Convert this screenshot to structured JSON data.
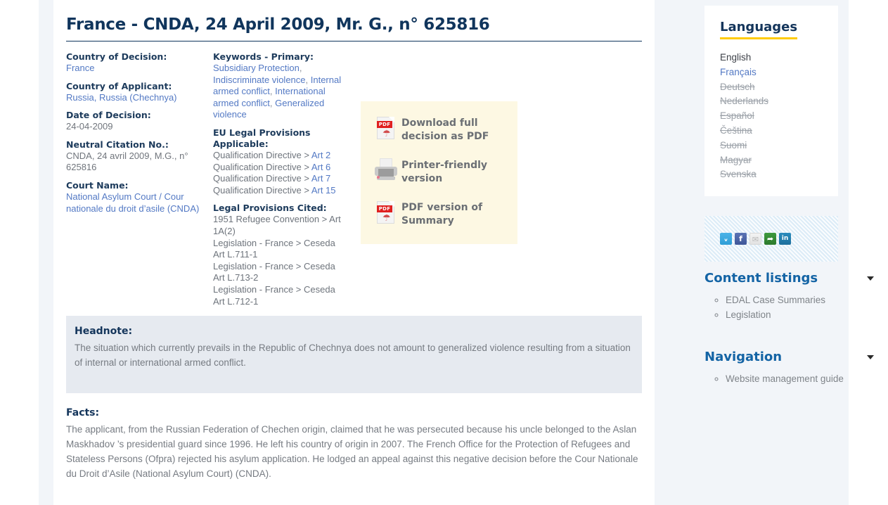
{
  "page": {
    "title": "France - CNDA, 24 April 2009, Mr. G., n° 625816"
  },
  "meta": {
    "left_fields": [
      {
        "label": "Country of Decision:",
        "value": "France",
        "is_link": true
      },
      {
        "label": "Country of Applicant:",
        "value": "Russia, Russia (Chechnya)",
        "is_link": true
      },
      {
        "label": "Date of Decision:",
        "value": "24-04-2009",
        "is_link": false
      },
      {
        "label": "Neutral Citation No.:",
        "value": "CNDA, 24 avril 2009, M.G., n° 625816",
        "is_link": false
      },
      {
        "label": "Court Name:",
        "value": "National Asylum Court / Cour nationale du droit d’asile (CNDA)",
        "is_link": true
      }
    ],
    "keywords": {
      "label": "Keywords - Primary:",
      "items": [
        "Subsidiary Protection",
        "Indiscriminate violence",
        "Internal armed conflict",
        "International armed conflict",
        "Generalized violence"
      ]
    },
    "eu_provisions": {
      "label": "EU Legal Provisions Applicable:",
      "items": [
        {
          "source": "Qualification Directive > ",
          "article": "Art 2"
        },
        {
          "source": "Qualification Directive > ",
          "article": "Art 6"
        },
        {
          "source": "Qualification Directive > ",
          "article": "Art 7"
        },
        {
          "source": "Qualification Directive > ",
          "article": "Art 15"
        }
      ]
    },
    "cited_provisions": {
      "label": "Legal Provisions Cited:",
      "items": [
        "1951 Refugee Convention > Art 1A(2)",
        "Legislation - France > Ceseda Art L.711-1",
        "Legislation - France > Ceseda Art L.713-2",
        "Legislation - France > Ceseda Art L.712-1"
      ]
    }
  },
  "downloads": {
    "items": [
      {
        "icon": "pdf-icon",
        "label": "Download full decision as PDF"
      },
      {
        "icon": "printer-icon",
        "label": "Printer-friendly version"
      },
      {
        "icon": "pdf-icon",
        "label": "PDF version of Summary"
      }
    ]
  },
  "headnote": {
    "title": "Headnote:",
    "text": "The situation which currently prevails in the Republic of Chechnya does not amount to generalized violence resulting from a situation of internal or international armed conflict."
  },
  "facts": {
    "title": "Facts:",
    "text": "The applicant, from the Russian Federation of Chechen origin, claimed that he was persecuted because his uncle belonged to the Aslan Maskhadov ’s  presidential guard since 1996. He left his country of origin in 2007. The French Office for the Protection of Refugees and Stateless Persons (Ofpra) rejected his asylum application. He lodged an appeal against this negative decision before the Cour Nationale du Droit d’Asile (National Asylum Court) (CNDA)."
  },
  "sidebar": {
    "languages": {
      "heading": "Languages",
      "items": [
        {
          "label": "English",
          "state": "current"
        },
        {
          "label": "Français",
          "state": "link"
        },
        {
          "label": "Deutsch",
          "state": "disabled"
        },
        {
          "label": "Nederlands",
          "state": "disabled"
        },
        {
          "label": "Español",
          "state": "disabled"
        },
        {
          "label": "Čeština",
          "state": "disabled"
        },
        {
          "label": "Suomi",
          "state": "disabled"
        },
        {
          "label": "Magyar",
          "state": "disabled"
        },
        {
          "label": "Svenska",
          "state": "disabled"
        }
      ]
    },
    "social": {
      "icons": [
        {
          "name": "twitter-icon",
          "glyph": "ᵥ",
          "color": "#2f9ed6"
        },
        {
          "name": "facebook-icon",
          "glyph": "f",
          "color": "#3f5799"
        },
        {
          "name": "email-icon",
          "glyph": "✉",
          "color": "#e2e2e2"
        },
        {
          "name": "share-icon",
          "glyph": "➦",
          "color": "#2d7a2d"
        },
        {
          "name": "linkedin-icon",
          "glyph": "in",
          "color": "#1d6f9c"
        }
      ]
    },
    "content_listings": {
      "heading": "Content listings",
      "items": [
        "EDAL Case Summaries",
        "Legislation"
      ]
    },
    "navigation": {
      "heading": "Navigation",
      "items": [
        "Website management guide"
      ]
    }
  },
  "colors": {
    "page_background": "#f2f5f9",
    "title": "#10355c",
    "link": "#5379c4",
    "heading_blue": "#1464a5",
    "accent_yellow": "#ffcb05",
    "downloads_panel": "#fdf8e3",
    "headnote_background": "#e6eaf0"
  }
}
